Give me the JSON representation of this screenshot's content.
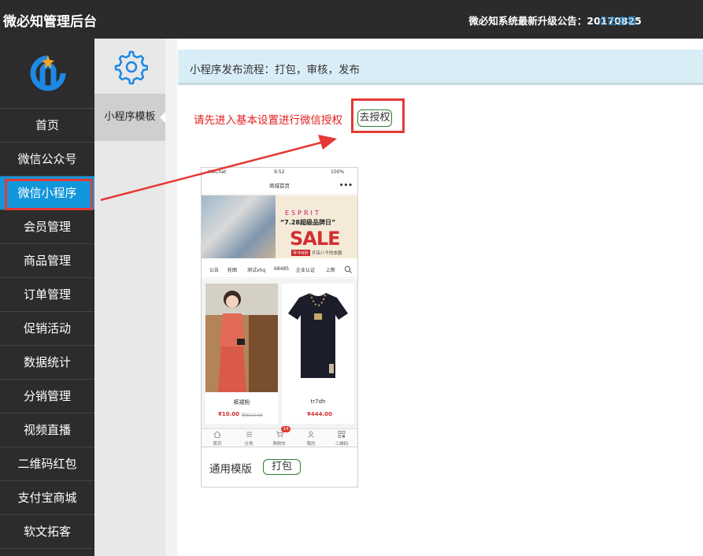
{
  "header": {
    "app_title": "微必知管理后台",
    "notice": "微必知系统最新升级公告：20170825",
    "notice_link": "点击查看"
  },
  "sidebar": {
    "items": [
      {
        "label": "首页"
      },
      {
        "label": "微信公众号"
      },
      {
        "label": "微信小程序"
      },
      {
        "label": "会员管理"
      },
      {
        "label": "商品管理"
      },
      {
        "label": "订单管理"
      },
      {
        "label": "促销活动"
      },
      {
        "label": "数据统计"
      },
      {
        "label": "分销管理"
      },
      {
        "label": "视频直播"
      },
      {
        "label": "二维码红包"
      },
      {
        "label": "支付宝商城"
      },
      {
        "label": "软文拓客"
      }
    ],
    "active_index": 2
  },
  "subpanel": {
    "item": "小程序模板"
  },
  "main": {
    "tip": "小程序发布流程：打包，审核，发布",
    "auth_message": "请先进入基本设置进行微信授权",
    "auth_button": "去授权",
    "template_card": {
      "name": "通用模版",
      "pack_button": "打包",
      "preview": {
        "status_carrier": "WeChat",
        "status_time": "9:52",
        "status_battery": "100%",
        "nav_title": "商城首页",
        "banner_brand": "ESPRIT",
        "banner_slogan": "“7.28超级品牌日”",
        "banner_sale": "SALE",
        "banner_tag": "年中8折",
        "banner_sub": "开店八千的衣服",
        "categories": [
          "公告",
          "轮图",
          "测试xhq",
          "68485",
          "企业认证",
          "上新"
        ],
        "products": [
          {
            "name": "裤裙粉",
            "price": "¥10.00",
            "old_price": "原价12.00"
          },
          {
            "name": "tr7dh",
            "price": "¥444.00"
          }
        ],
        "tabs": [
          "首页",
          "分类",
          "购物车",
          "我的",
          "二维码"
        ],
        "cart_count": "14"
      }
    }
  },
  "colors": {
    "topbar": "#2b2b2b",
    "sidebar": "#2c2c2c",
    "active": "#1296db",
    "highlight": "#e53935",
    "tip_bg": "#d9edf7"
  }
}
